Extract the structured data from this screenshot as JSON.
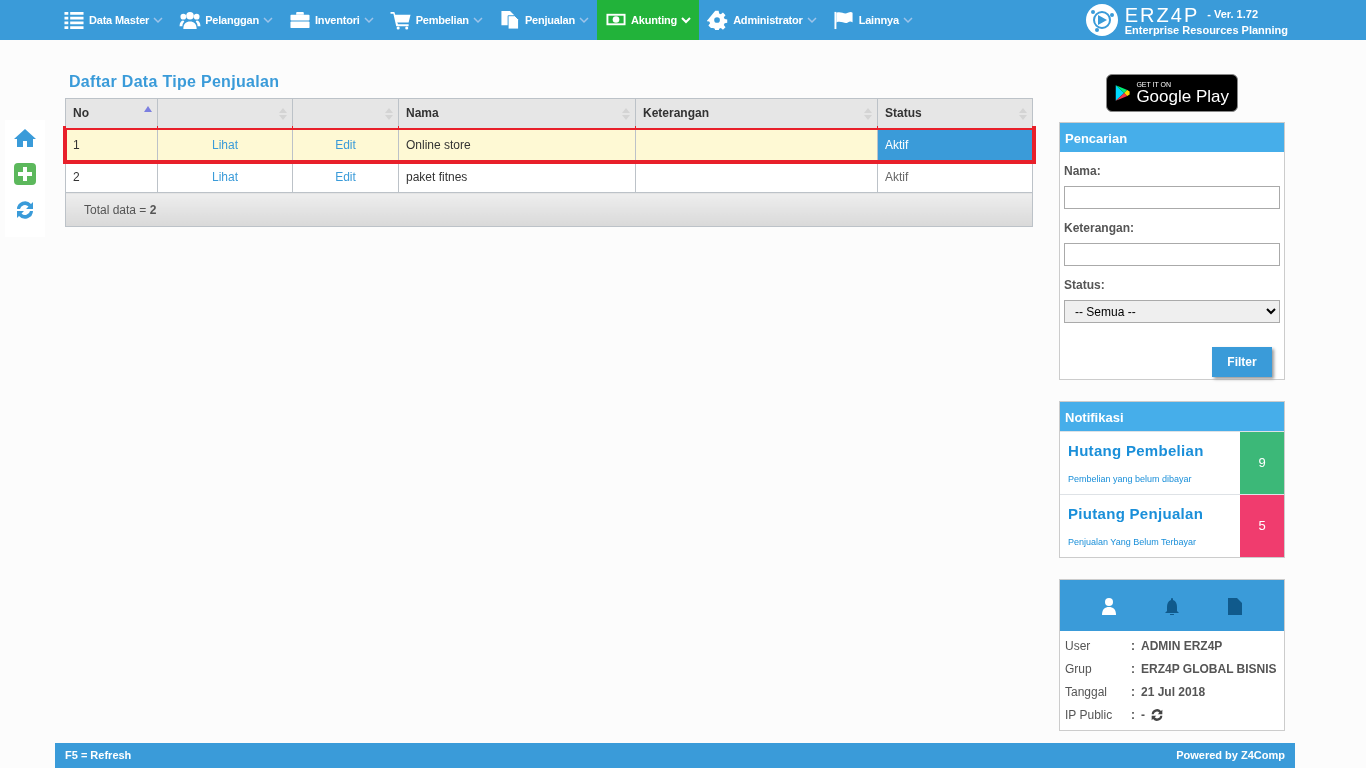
{
  "nav": {
    "items": [
      {
        "label": "Data Master",
        "kind": "list",
        "selected": false
      },
      {
        "label": "Pelanggan",
        "kind": "users",
        "selected": false
      },
      {
        "label": "Inventori",
        "kind": "briefcase",
        "selected": false
      },
      {
        "label": "Pembelian",
        "kind": "cart",
        "selected": false
      },
      {
        "label": "Penjualan",
        "kind": "documents",
        "selected": false
      },
      {
        "label": "Akunting",
        "kind": "money",
        "selected": true
      },
      {
        "label": "Administrator",
        "kind": "gear",
        "selected": false
      },
      {
        "label": "Lainnya",
        "kind": "flag",
        "selected": false
      }
    ],
    "brand": {
      "name": "ERZ4P",
      "version": "- Ver. 1.72",
      "tagline": "Enterprise Resources Planning"
    }
  },
  "page_title": "Daftar Data Tipe Penjualan",
  "table": {
    "columns": [
      {
        "label": "No",
        "sorted": true
      },
      {
        "sorted": false
      },
      {
        "sorted": false
      },
      {
        "label": "Nama",
        "sorted": false
      },
      {
        "label": "Keterangan",
        "sorted": false
      },
      {
        "label": "Status",
        "sorted": false
      }
    ],
    "rows": [
      {
        "no": "1",
        "view": "Lihat",
        "edit": "Edit",
        "nama": "Online store",
        "status": "Aktif",
        "selected": true,
        "highlighted": true
      },
      {
        "no": "2",
        "view": "Lihat",
        "edit": "Edit",
        "nama": "paket fitnes",
        "status": "Aktif",
        "selected": false,
        "highlighted": false
      }
    ],
    "footer": {
      "label": "Total data =",
      "value": "2"
    }
  },
  "play_badge": {
    "small": "GET IT ON",
    "big": "Google Play"
  },
  "search": {
    "title": "Pencarian",
    "fields": [
      {
        "label": "Nama:",
        "kind": "text"
      },
      {
        "label": "Keterangan:",
        "kind": "text"
      },
      {
        "label": "Status:",
        "kind": "select",
        "value": "-- Semua --"
      }
    ],
    "button": "Filter"
  },
  "notifications": {
    "title": "Notifikasi",
    "items": [
      {
        "title": "Hutang Pembelian",
        "subtitle": "Pembelian yang belum dibayar",
        "count": "9",
        "color": "#3cb878"
      },
      {
        "title": "Piutang Penjualan",
        "subtitle": "Penjualan Yang Belum Terbayar",
        "count": "5",
        "color": "#f03c6e"
      }
    ]
  },
  "user_panel": {
    "tabs": [
      {
        "kind": "user",
        "selected": true
      },
      {
        "kind": "bell",
        "selected": false
      },
      {
        "kind": "file",
        "selected": false
      }
    ],
    "info": [
      {
        "label": "User",
        "separator": ":",
        "value": "ADMIN ERZ4P"
      },
      {
        "label": "Grup",
        "separator": ":",
        "value": "ERZ4P GLOBAL BISNIS"
      },
      {
        "label": "Tanggal",
        "separator": ":",
        "value": "21 Jul 2018"
      },
      {
        "label": "IP Public",
        "separator": ":",
        "value": "-",
        "refresh": true
      }
    ]
  },
  "status_bar": {
    "left": "F5 = Refresh",
    "right": "Powered by Z4Comp"
  }
}
